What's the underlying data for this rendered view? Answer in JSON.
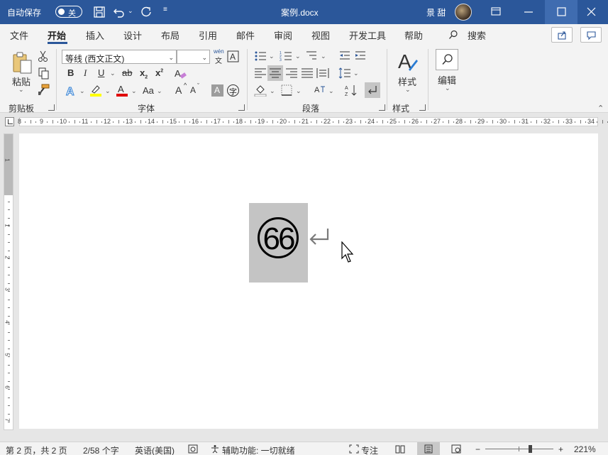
{
  "titlebar": {
    "autosave_label": "自动保存",
    "autosave_state": "关",
    "doc_title": "案例.docx",
    "user_name": "景 甜"
  },
  "tabs": [
    "文件",
    "开始",
    "插入",
    "设计",
    "布局",
    "引用",
    "邮件",
    "审阅",
    "视图",
    "开发工具",
    "帮助"
  ],
  "active_tab": "开始",
  "search_label": "搜索",
  "ribbon": {
    "clipboard": {
      "paste": "粘贴",
      "group": "剪贴板"
    },
    "font": {
      "name": "等线 (西文正文)",
      "size": "",
      "wen_top": "wén",
      "wen_bottom": "文",
      "group": "字体",
      "bold": "B",
      "italic": "I",
      "underline": "U",
      "strike": "ab",
      "sub": "x",
      "sup": "x",
      "aa": "Aa",
      "grow": "A",
      "shrink": "A",
      "char_shade": "A",
      "enclose": "字"
    },
    "paragraph": {
      "group": "段落"
    },
    "styles": {
      "label": "样式",
      "group": "样式"
    },
    "editing": {
      "label": "编辑"
    }
  },
  "ruler": [
    "8",
    "9",
    "10",
    "11",
    "12",
    "13",
    "14",
    "15",
    "16",
    "17",
    "18",
    "19",
    "20",
    "21",
    "22",
    "23",
    "24",
    "25",
    "26",
    "27",
    "28",
    "29",
    "30",
    "31",
    "32",
    "33",
    "34"
  ],
  "vruler": [
    "1",
    "1",
    "2",
    "3",
    "4",
    "5",
    "6",
    "7"
  ],
  "document": {
    "enclosed_char": "66"
  },
  "status": {
    "page": "第 2 页，共 2 页",
    "words": "2/58 个字",
    "language": "英语(美国)",
    "accessibility": "辅助功能: 一切就绪",
    "focus": "专注",
    "zoom": "221%",
    "minus": "−",
    "plus": "+"
  },
  "colors": {
    "titlebar": "#2b579a",
    "ribbon": "#f3f3f3",
    "highlight": "#ffff00",
    "font_color": "#e00000",
    "selection": "#c4c4c4"
  }
}
